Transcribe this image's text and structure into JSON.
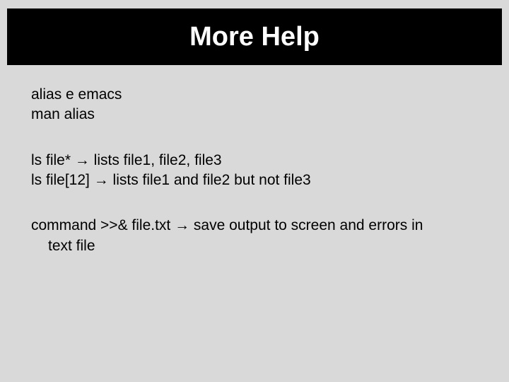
{
  "title": "More Help",
  "block1": {
    "line1": "alias  e  emacs",
    "line2": "man   alias"
  },
  "block2": {
    "line1": "ls file* → lists file1, file2, file3",
    "line2": "ls  file[12]  → lists file1 and file2 but not file3"
  },
  "block3": {
    "line1": "command >>& file.txt → save output to screen and errors in",
    "line2": "text file"
  }
}
